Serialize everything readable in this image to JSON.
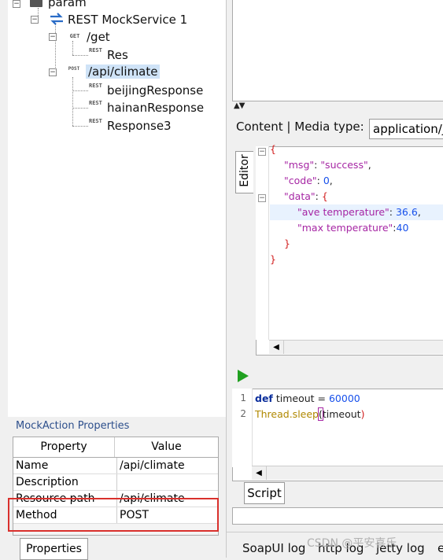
{
  "tree": {
    "root_label": "param",
    "service_label": "REST MockService 1",
    "actions": [
      {
        "method_icon": "GET",
        "label": "/get",
        "responses": [
          "Res"
        ]
      },
      {
        "method_icon": "POST",
        "label": "/api/climate",
        "responses": [
          "beijingResponse",
          "hainanResponse",
          "Response3"
        ]
      }
    ],
    "response_icon": "REST"
  },
  "properties": {
    "title": "MockAction Properties",
    "headers": [
      "Property",
      "Value"
    ],
    "rows": [
      {
        "name": "Name",
        "value": "/api/climate"
      },
      {
        "name": "Description",
        "value": ""
      },
      {
        "name": "Resource path",
        "value": "/api/climate"
      },
      {
        "name": "Method",
        "value": "POST"
      }
    ],
    "tab_label": "Properties"
  },
  "response_editor": {
    "content_label": "Content | Media type:",
    "media_type": "application/json",
    "editor_tab": "Editor",
    "json_lines": [
      {
        "open": "{"
      },
      {
        "key": "\"msg\"",
        "sep": ": ",
        "str": "\"success\"",
        "end": ","
      },
      {
        "key": "\"code\"",
        "sep": ": ",
        "num": "0",
        "end": ","
      },
      {
        "key": "\"data\"",
        "sep": ": ",
        "open": "{"
      },
      {
        "key": "\"ave temperature\"",
        "sep": ": ",
        "num": "36.6",
        "end": ","
      },
      {
        "key": "\"max temperature\"",
        "sep": ":",
        "num": "40"
      },
      {
        "close": "}"
      },
      {
        "close": "}"
      }
    ]
  },
  "script": {
    "line_numbers": [
      "1",
      "2"
    ],
    "line1": {
      "kw": "def",
      "rest": " timeout = ",
      "num": "60000"
    },
    "line2": {
      "call": "Thread.sleep",
      "paren_open": "(",
      "arg": "timeout",
      "paren_close": ")"
    },
    "button_label": "Script"
  },
  "log_tabs": [
    "SoapUI log",
    "http log",
    "jetty log",
    "e"
  ],
  "watermark": "CSDN @平安喜乐",
  "colors": {
    "selection": "#cfe3f7",
    "highlight_box": "#d9302c",
    "run_icon": "#20a020"
  }
}
